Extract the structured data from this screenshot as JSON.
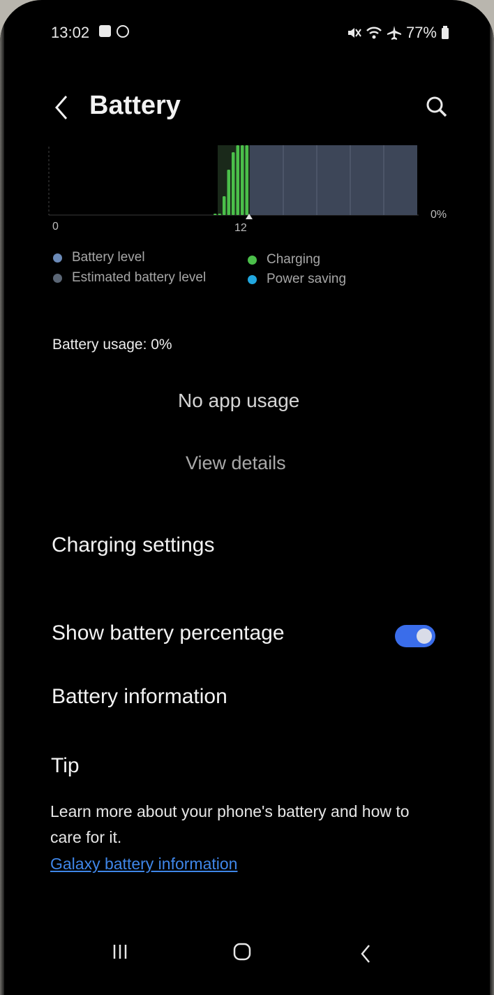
{
  "status_bar": {
    "time": "13:02",
    "battery_percent": "77%",
    "icons": [
      "gallery-icon",
      "circle-icon",
      "mute-icon",
      "wifi-icon",
      "airplane-icon",
      "battery-icon"
    ]
  },
  "header": {
    "title": "Battery",
    "back_icon": "chevron-left-icon",
    "search_icon": "search-icon"
  },
  "chart_data": {
    "type": "bar",
    "x_tick_labels": [
      "0",
      "12"
    ],
    "y_tick_labels": [
      "0%"
    ],
    "values": [
      1,
      2,
      27,
      65,
      90,
      100,
      100,
      100
    ],
    "legend": [
      "Battery level",
      "Estimated battery level",
      "Charging",
      "Power saving"
    ],
    "colors": {
      "battery_level": "#6b8ab8",
      "estimated_battery_level": "#5b6675",
      "charging": "#4bbf4a",
      "power_saving": "#21a7df",
      "estimate_area": "#3d4658"
    }
  },
  "usage": {
    "label": "Battery usage: 0%",
    "empty_text": "No app usage",
    "view_details": "View details"
  },
  "menu": {
    "charging_settings": "Charging settings",
    "show_battery_percentage": "Show battery percentage",
    "show_battery_percentage_on": true,
    "battery_information": "Battery information"
  },
  "tip": {
    "title": "Tip",
    "body": "Learn more about your phone's battery and how to care for it.",
    "link": "Galaxy battery information"
  },
  "nav_bar": {
    "recents_icon": "recents-icon",
    "home_icon": "home-icon",
    "back_icon": "back-icon"
  }
}
